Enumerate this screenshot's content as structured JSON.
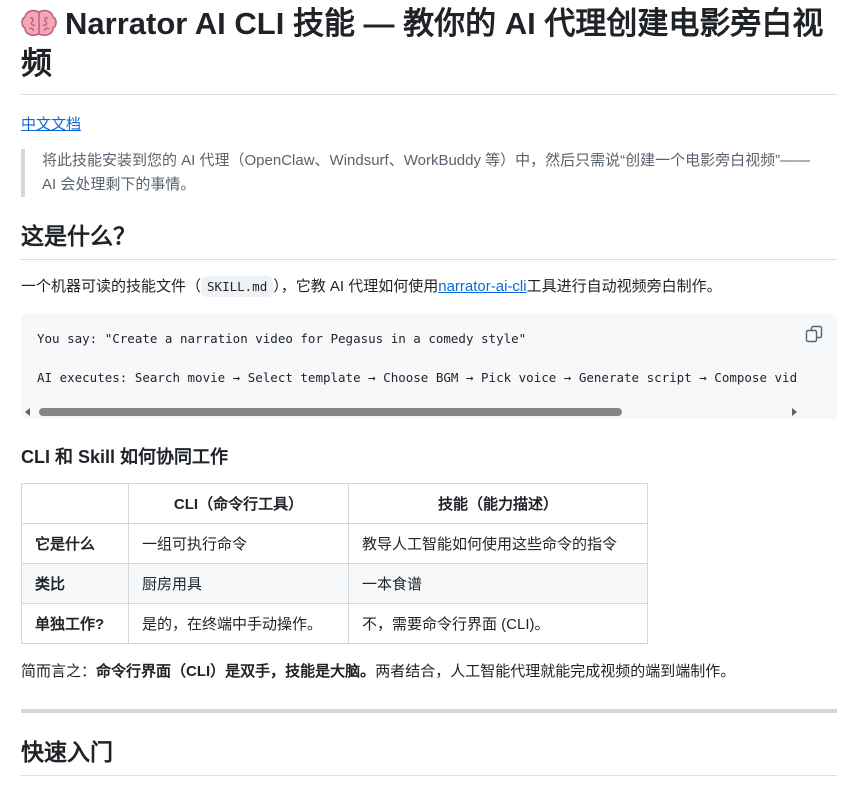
{
  "title": "Narrator AI CLI 技能 — 教你的 AI 代理创建电影旁白视频",
  "title_icon": "brain-icon",
  "lang_link": "中文文档",
  "intro_quote": "将此技能安装到您的 AI 代理（OpenClaw、Windsurf、WorkBuddy 等）中，然后只需说“创建一个电影旁白视频”——AI 会处理剩下的事情。",
  "what_is_it": {
    "heading": "这是什么？",
    "text_before": "一个机器可读的技能文件（",
    "code": "SKILL.md",
    "text_middle": "），它教 AI 代理如何使用",
    "link": "narrator-ai-cli",
    "text_after": "工具进行自动视频旁白制作。"
  },
  "code_block": {
    "line1": "You say: \"Create a narration video for Pegasus in a comedy style\"",
    "line2": "AI executes: Search movie → Select template → Choose BGM → Pick voice → Generate script → Compose vid",
    "copy_icon": "copy-icon"
  },
  "cli_skill": {
    "heading": "CLI 和 Skill 如何协同工作",
    "columns": [
      "",
      "CLI（命令行工具）",
      "技能（能力描述）"
    ],
    "rows": [
      [
        "它是什么",
        "一组可执行命令",
        "教导人工智能如何使用这些命令的指令"
      ],
      [
        "类比",
        "厨房用具",
        "一本食谱"
      ],
      [
        "单独工作?",
        "是的，在终端中手动操作。",
        "不，需要命令行界面 (CLI)。"
      ]
    ],
    "summary_prefix": "简而言之：",
    "summary_bold": "命令行界面（CLI）是双手，技能是大脑。",
    "summary_suffix": "两者结合，人工智能代理就能完成视频的端到端制作。"
  },
  "quick_start": {
    "heading": "快速入门"
  }
}
